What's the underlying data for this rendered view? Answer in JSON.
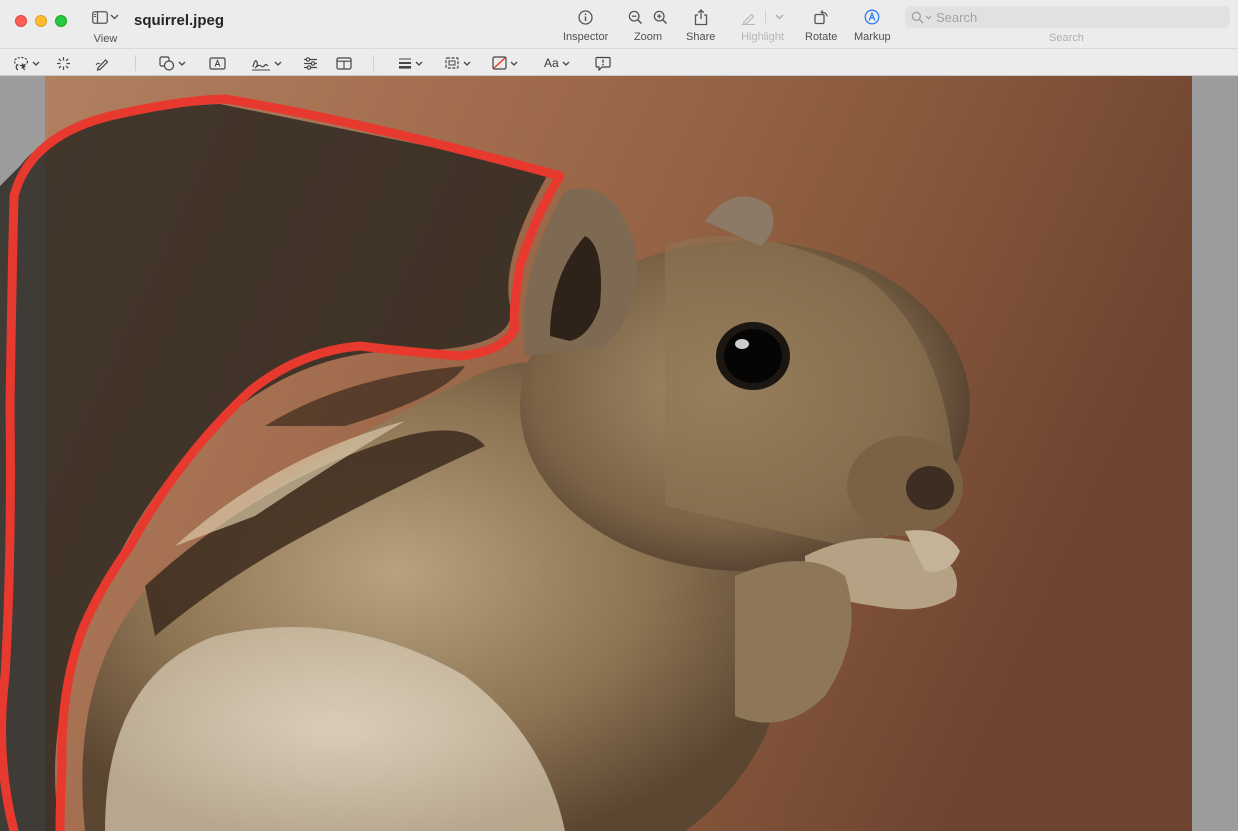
{
  "window": {
    "title": "squirrel.jpeg"
  },
  "toolbar": {
    "view_label": "View",
    "inspector_label": "Inspector",
    "zoom_label": "Zoom",
    "share_label": "Share",
    "highlight_label": "Highlight",
    "rotate_label": "Rotate",
    "markup_label": "Markup",
    "search_placeholder": "Search",
    "search_label": "Search"
  },
  "markup_toolbar": {
    "text_style_label": "Aa"
  },
  "colors": {
    "selection_outline": "#e8392f",
    "markup_active": "#2f7cf6",
    "background_brown": "#8a5a3c"
  },
  "icons": [
    "sidebar-icon",
    "info-icon",
    "zoom-out-icon",
    "zoom-in-icon",
    "share-icon",
    "highlight-pen-icon",
    "rotate-icon",
    "markup-icon",
    "search-icon",
    "lasso-selection-icon",
    "instant-alpha-icon",
    "sketch-icon",
    "shapes-icon",
    "text-box-icon",
    "signature-icon",
    "adjust-color-icon",
    "page-layout-icon",
    "line-style-icon",
    "border-color-icon",
    "fill-color-icon",
    "note-icon"
  ]
}
